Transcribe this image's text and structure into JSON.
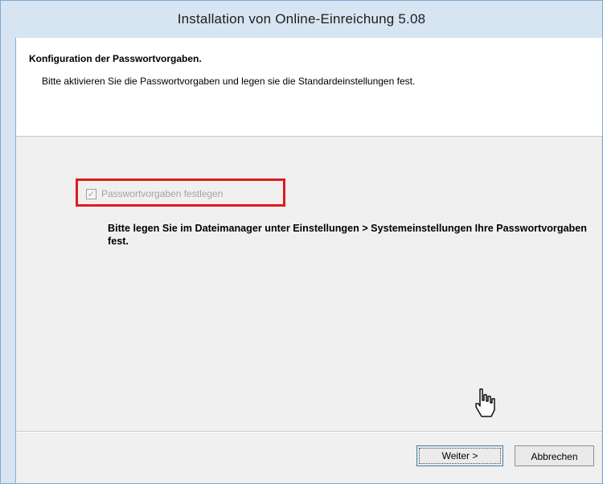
{
  "window": {
    "title": "Installation von Online-Einreichung 5.08"
  },
  "header": {
    "title": "Konfiguration der Passwortvorgaben.",
    "description": "Bitte aktivieren Sie die Passwortvorgaben und legen sie die Standardeinstellungen fest."
  },
  "main": {
    "checkbox": {
      "label": "Passwortvorgaben festlegen",
      "checked": true,
      "enabled": false
    },
    "info_text": "Bitte legen Sie im Dateimanager unter Einstellungen > Systemeinstellungen Ihre Passwortvorgaben fest."
  },
  "footer": {
    "next_label": "Weiter >",
    "cancel_label": "Abbrechen"
  },
  "colors": {
    "highlight_border": "#e01b1b",
    "title_bar": "#d7e4f2",
    "dialog_background": "#f0f0f0"
  },
  "icons": {
    "checkbox": "check-mark",
    "cursor": "hand-pointer"
  }
}
